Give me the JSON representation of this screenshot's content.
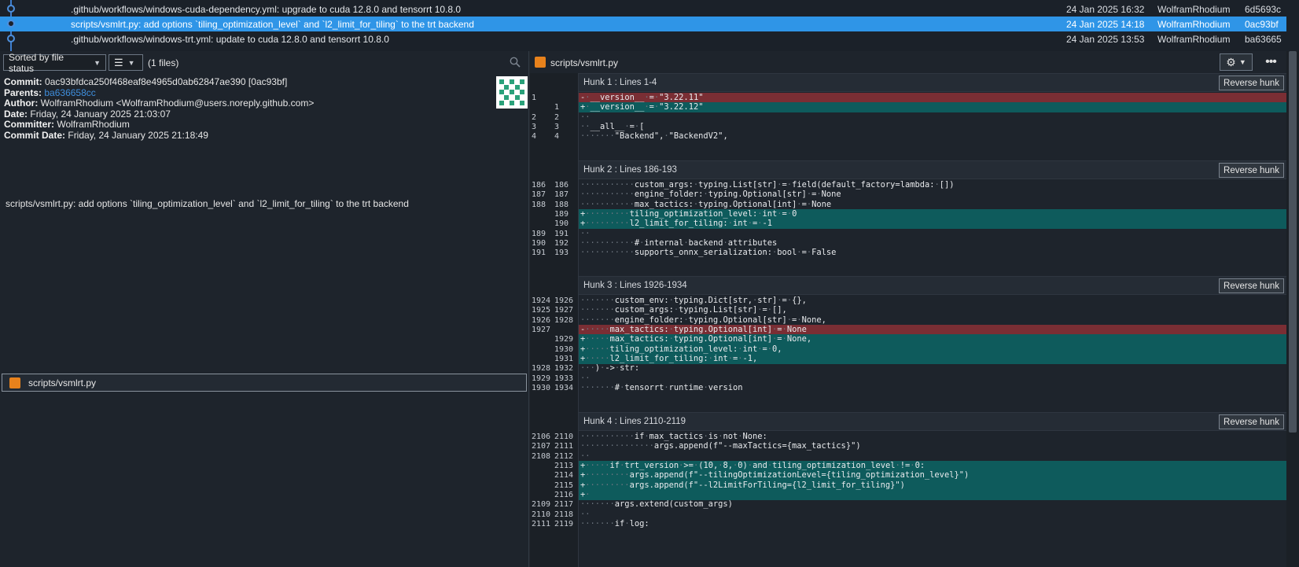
{
  "history": {
    "rows": [
      {
        "message": ".github/workflows/windows-cuda-dependency.yml: upgrade to cuda 12.8.0 and tensorrt 10.8.0",
        "date": "24 Jan 2025 16:32",
        "author": "WolframRhodium",
        "sha": "6d5693c"
      },
      {
        "message": "scripts/vsmlrt.py: add options `tiling_optimization_level` and `l2_limit_for_tiling` to the trt backend",
        "date": "24 Jan 2025 14:18",
        "author": "WolframRhodium",
        "sha": "0ac93bf"
      },
      {
        "message": ".github/workflows/windows-trt.yml: update to cuda 12.8.0 and tensorrt 10.8.0",
        "date": "24 Jan 2025 13:53",
        "author": "WolframRhodium",
        "sha": "ba63665"
      }
    ],
    "selected_index": 1,
    "accent": "#2f95e7"
  },
  "toolbar": {
    "sort_label": "Sorted by file status",
    "view_icon": "list-icon",
    "file_count": "(1 files)",
    "search_icon": "search-icon"
  },
  "commit": {
    "commit_label": "Commit:",
    "commit_value": "0ac93bfdca250f468eaf8e4965d0ab62847ae390 [0ac93bf]",
    "parents_label": "Parents:",
    "parents_value": "ba636658cc",
    "author_label": "Author:",
    "author_value": "WolframRhodium <WolframRhodium@users.noreply.github.com>",
    "date_label": "Date:",
    "date_value": "Friday, 24 January 2025 21:03:07",
    "committer_label": "Committer:",
    "committer_value": "WolframRhodium",
    "commit_date_label": "Commit Date:",
    "commit_date_value": "Friday, 24 January 2025 21:18:49",
    "message": "scripts/vsmlrt.py: add options `tiling_optimization_level` and `l2_limit_for_tiling` to the trt backend"
  },
  "files": [
    {
      "name": "scripts/vsmlrt.py",
      "status_color": "#e8821c"
    }
  ],
  "diff": {
    "file_title": "scripts/vsmlrt.py",
    "settings_icon": "gear-icon",
    "more_icon": "more-icon",
    "reverse_label": "Reverse hunk",
    "hunks": [
      {
        "title": "Hunk 1 : Lines 1-4",
        "lines": [
          {
            "type": "del",
            "old": "1",
            "new": "",
            "text": "-·__version__·=·\"3.22.11\""
          },
          {
            "type": "add",
            "old": "",
            "new": "1",
            "text": "+·__version__·=·\"3.22.12\""
          },
          {
            "type": "ctx",
            "old": "2",
            "new": "2",
            "text": "··"
          },
          {
            "type": "ctx",
            "old": "3",
            "new": "3",
            "text": "··__all__·=·["
          },
          {
            "type": "ctx",
            "old": "4",
            "new": "4",
            "text": "·······\"Backend\",·\"BackendV2\","
          }
        ]
      },
      {
        "title": "Hunk 2 : Lines 186-193",
        "lines": [
          {
            "type": "ctx",
            "old": "186",
            "new": "186",
            "text": "···········custom_args:·typing.List[str]·=·field(default_factory=lambda:·[])"
          },
          {
            "type": "ctx",
            "old": "187",
            "new": "187",
            "text": "···········engine_folder:·typing.Optional[str]·=·None"
          },
          {
            "type": "ctx",
            "old": "188",
            "new": "188",
            "text": "···········max_tactics:·typing.Optional[int]·=·None"
          },
          {
            "type": "add",
            "old": "",
            "new": "189",
            "text": "+·········tiling_optimization_level:·int·=·0"
          },
          {
            "type": "add",
            "old": "",
            "new": "190",
            "text": "+·········l2_limit_for_tiling:·int·=·-1"
          },
          {
            "type": "ctx",
            "old": "189",
            "new": "191",
            "text": "··"
          },
          {
            "type": "ctx",
            "old": "190",
            "new": "192",
            "text": "···········#·internal·backend·attributes"
          },
          {
            "type": "ctx",
            "old": "191",
            "new": "193",
            "text": "···········supports_onnx_serialization:·bool·=·False"
          }
        ]
      },
      {
        "title": "Hunk 3 : Lines 1926-1934",
        "lines": [
          {
            "type": "ctx",
            "old": "1924",
            "new": "1926",
            "text": "·······custom_env:·typing.Dict[str,·str]·=·{},"
          },
          {
            "type": "ctx",
            "old": "1925",
            "new": "1927",
            "text": "·······custom_args:·typing.List[str]·=·[],"
          },
          {
            "type": "ctx",
            "old": "1926",
            "new": "1928",
            "text": "·······engine_folder:·typing.Optional[str]·=·None,"
          },
          {
            "type": "del",
            "old": "1927",
            "new": "",
            "text": "-·····max_tactics:·typing.Optional[int]·=·None"
          },
          {
            "type": "add",
            "old": "",
            "new": "1929",
            "text": "+·····max_tactics:·typing.Optional[int]·=·None,"
          },
          {
            "type": "add",
            "old": "",
            "new": "1930",
            "text": "+·····tiling_optimization_level:·int·=·0,"
          },
          {
            "type": "add",
            "old": "",
            "new": "1931",
            "text": "+·····l2_limit_for_tiling:·int·=·-1,"
          },
          {
            "type": "ctx",
            "old": "1928",
            "new": "1932",
            "text": "···)·->·str:"
          },
          {
            "type": "ctx",
            "old": "1929",
            "new": "1933",
            "text": "··"
          },
          {
            "type": "ctx",
            "old": "1930",
            "new": "1934",
            "text": "·······#·tensorrt·runtime·version"
          }
        ]
      },
      {
        "title": "Hunk 4 : Lines 2110-2119",
        "lines": [
          {
            "type": "ctx",
            "old": "2106",
            "new": "2110",
            "text": "···········if·max_tactics·is·not·None:"
          },
          {
            "type": "ctx",
            "old": "2107",
            "new": "2111",
            "text": "···············args.append(f\"--maxTactics={max_tactics}\")"
          },
          {
            "type": "ctx",
            "old": "2108",
            "new": "2112",
            "text": "··"
          },
          {
            "type": "add",
            "old": "",
            "new": "2113",
            "text": "+·····if·trt_version·>=·(10,·8,·0)·and·tiling_optimization_level·!=·0:"
          },
          {
            "type": "add",
            "old": "",
            "new": "2114",
            "text": "+·········args.append(f\"--tilingOptimizationLevel={tiling_optimization_level}\")"
          },
          {
            "type": "add",
            "old": "",
            "new": "2115",
            "text": "+·········args.append(f\"--l2LimitForTiling={l2_limit_for_tiling}\")"
          },
          {
            "type": "add",
            "old": "",
            "new": "2116",
            "text": "+·"
          },
          {
            "type": "ctx",
            "old": "2109",
            "new": "2117",
            "text": "·······args.extend(custom_args)"
          },
          {
            "type": "ctx",
            "old": "2110",
            "new": "2118",
            "text": "··"
          },
          {
            "type": "ctx",
            "old": "2111",
            "new": "2119",
            "text": "·······if·log:"
          }
        ]
      }
    ],
    "colors": {
      "added": "#0e5b5c",
      "removed": "#7a2e34"
    }
  }
}
